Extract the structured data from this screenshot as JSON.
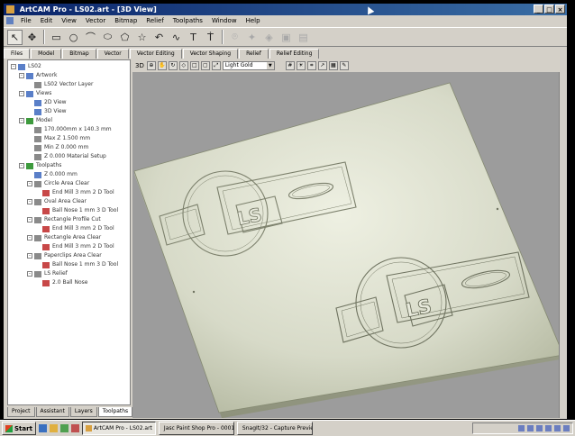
{
  "window": {
    "title": "ArtCAM Pro - LS02.art - [3D View]",
    "controls": [
      "_",
      "□",
      "×"
    ]
  },
  "menu": [
    "File",
    "Edit",
    "View",
    "Vector",
    "Bitmap",
    "Relief",
    "Toolpaths",
    "Window",
    "Help"
  ],
  "toolbar": {
    "tools": [
      {
        "icon": "select-arrow-icon",
        "glyph": "↖",
        "active": true,
        "enabled": true
      },
      {
        "icon": "node-edit-icon",
        "glyph": "✥",
        "active": false,
        "enabled": true
      },
      {
        "icon": "rectangle-icon",
        "glyph": "▭",
        "active": false,
        "enabled": true
      },
      {
        "icon": "circle-icon",
        "glyph": "○",
        "active": false,
        "enabled": true
      },
      {
        "icon": "polyline-icon",
        "glyph": "⌒",
        "active": false,
        "enabled": true
      },
      {
        "icon": "ellipse-icon",
        "glyph": "⬭",
        "active": false,
        "enabled": true
      },
      {
        "icon": "polygon-icon",
        "glyph": "⬠",
        "active": false,
        "enabled": true
      },
      {
        "icon": "star-icon",
        "glyph": "☆",
        "active": false,
        "enabled": true
      },
      {
        "icon": "arc-icon",
        "glyph": "↶",
        "active": false,
        "enabled": true
      },
      {
        "icon": "curve-icon",
        "glyph": "∿",
        "active": false,
        "enabled": true
      },
      {
        "icon": "text-icon",
        "glyph": "T",
        "active": false,
        "enabled": true
      },
      {
        "icon": "text-on-curve-icon",
        "glyph": "Ṫ",
        "active": false,
        "enabled": true
      },
      {
        "icon": "offset-icon",
        "glyph": "⌾",
        "active": false,
        "enabled": false
      },
      {
        "icon": "weld-icon",
        "glyph": "✦",
        "active": false,
        "enabled": false
      },
      {
        "icon": "trim-icon",
        "glyph": "◈",
        "active": false,
        "enabled": false
      },
      {
        "icon": "group-icon",
        "glyph": "▣",
        "active": false,
        "enabled": false
      },
      {
        "icon": "ungroup-icon",
        "glyph": "▤",
        "active": false,
        "enabled": false
      }
    ]
  },
  "panel_tabs": [
    {
      "label": "Files",
      "active": true
    },
    {
      "label": "Model",
      "active": false
    },
    {
      "label": "Bitmap",
      "active": false
    },
    {
      "label": "Vector",
      "active": false
    },
    {
      "label": "Vector Editing",
      "active": false
    },
    {
      "label": "Vector Shaping",
      "active": false
    },
    {
      "label": "Relief",
      "active": false
    },
    {
      "label": "Relief Editing",
      "active": false
    }
  ],
  "project_tree": [
    {
      "level": 0,
      "toggle": "-",
      "icon": "blue",
      "label": "LS02"
    },
    {
      "level": 1,
      "toggle": "-",
      "icon": "blue",
      "label": "Artwork"
    },
    {
      "level": 2,
      "toggle": "",
      "icon": "grey",
      "label": "LS02 Vector Layer"
    },
    {
      "level": 1,
      "toggle": "-",
      "icon": "blue",
      "label": "Views"
    },
    {
      "level": 2,
      "toggle": "",
      "icon": "blue",
      "label": "2D View"
    },
    {
      "level": 2,
      "toggle": "",
      "icon": "blue",
      "label": "3D View"
    },
    {
      "level": 1,
      "toggle": "-",
      "icon": "green",
      "label": "Model"
    },
    {
      "level": 2,
      "toggle": "",
      "icon": "grey",
      "label": "170.000mm x 140.3 mm"
    },
    {
      "level": 2,
      "toggle": "",
      "icon": "grey",
      "label": "Max Z 1.500 mm"
    },
    {
      "level": 2,
      "toggle": "",
      "icon": "grey",
      "label": "Min Z 0.000 mm"
    },
    {
      "level": 2,
      "toggle": "",
      "icon": "grey",
      "label": "Z 0.000 Material Setup"
    },
    {
      "level": 1,
      "toggle": "-",
      "icon": "green",
      "label": "Toolpaths"
    },
    {
      "level": 2,
      "toggle": "",
      "icon": "blue",
      "label": "Z 0.000 mm"
    },
    {
      "level": 2,
      "toggle": "-",
      "icon": "grey",
      "label": "Circle Area Clear"
    },
    {
      "level": 3,
      "toggle": "",
      "icon": "red",
      "label": "End Mill 3 mm 2 D Tool"
    },
    {
      "level": 2,
      "toggle": "-",
      "icon": "grey",
      "label": "Oval Area Clear"
    },
    {
      "level": 3,
      "toggle": "",
      "icon": "red",
      "label": "Ball Nose 1 mm 3 D Tool"
    },
    {
      "level": 2,
      "toggle": "-",
      "icon": "grey",
      "label": "Rectangle Profile Cut"
    },
    {
      "level": 3,
      "toggle": "",
      "icon": "red",
      "label": "End Mill 3 mm 2 D Tool"
    },
    {
      "level": 2,
      "toggle": "-",
      "icon": "grey",
      "label": "Rectangle Area Clear"
    },
    {
      "level": 3,
      "toggle": "",
      "icon": "red",
      "label": "End Mill 3 mm 2 D Tool"
    },
    {
      "level": 2,
      "toggle": "-",
      "icon": "grey",
      "label": "Paperclips Area Clear"
    },
    {
      "level": 3,
      "toggle": "",
      "icon": "red",
      "label": "Ball Nose 1 mm 3 D Tool"
    },
    {
      "level": 2,
      "toggle": "-",
      "icon": "grey",
      "label": "LS Relief"
    },
    {
      "level": 3,
      "toggle": "",
      "icon": "red",
      "label": "2.0 Ball Nose"
    }
  ],
  "bottom_tabs": [
    {
      "label": "Project",
      "active": false
    },
    {
      "label": "Assistant",
      "active": false
    },
    {
      "label": "Layers",
      "active": false
    },
    {
      "label": "Toolpaths",
      "active": true
    }
  ],
  "viewbar": {
    "view_label": "3D",
    "mode_select": "Light Gold"
  },
  "taskbar": {
    "start_label": "Start",
    "items": [
      {
        "label": "ArtCAM Pro - LS02.art",
        "active": true
      },
      {
        "label": "Jasc Paint Shop Pro - 0001",
        "active": false
      },
      {
        "label": "SnagIt/32 - Capture Preview",
        "active": false
      }
    ]
  },
  "colors": {
    "titlebar_start": "#0a246a",
    "titlebar_end": "#3a6ea5",
    "viewport_bg": "#9c9c9c",
    "relief_sheen": "#eef0e2",
    "relief_shade": "#a9ae94",
    "chrome": "#d4d0c8"
  }
}
